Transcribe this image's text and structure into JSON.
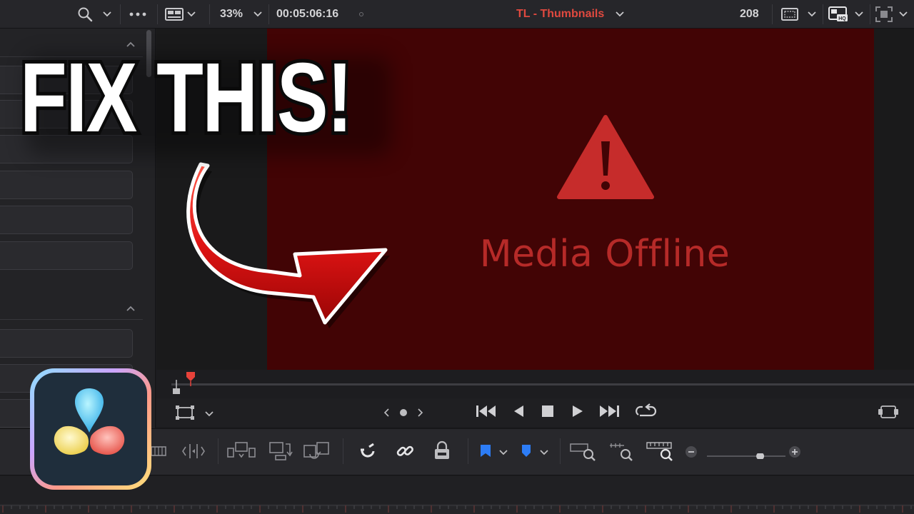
{
  "topbar": {
    "zoom": "33%",
    "timecode": "00:05:06:16",
    "timeline_title": "TL - Thumbnails",
    "frame_count": "208"
  },
  "viewer": {
    "offline_message": "Media Offline",
    "frame_color": "#420405",
    "message_color": "#b62a28"
  },
  "overlay": {
    "headline": "FIX THIS!",
    "arrow_color": "#e01414"
  },
  "icons": {
    "top": [
      "search-icon",
      "chevron-down-icon",
      "more-icon",
      "viewer-layout-icon",
      "chevron-down-icon",
      "clip-menu-icon",
      "aspect-icon",
      "chevron-down-icon",
      "hq-display-icon",
      "chevron-down-icon",
      "fullscreen-icon",
      "chevron-down-icon"
    ],
    "transport": [
      "go-to-start-icon",
      "play-reverse-icon",
      "stop-icon",
      "play-icon",
      "go-to-end-icon",
      "loop-icon"
    ],
    "toolbar": [
      "trim-icon",
      "insert-icon",
      "overwrite-icon",
      "replace-icon",
      "snapping-icon",
      "link-icon",
      "lock-icon",
      "flag-icon",
      "marker-icon",
      "zoom-full-icon",
      "zoom-detail-icon",
      "zoom-custom-icon",
      "zoom-out-icon",
      "zoom-in-icon"
    ]
  },
  "zoom_slider": {
    "level": 0.7
  },
  "app": {
    "logo": "davinci-resolve-logo"
  }
}
